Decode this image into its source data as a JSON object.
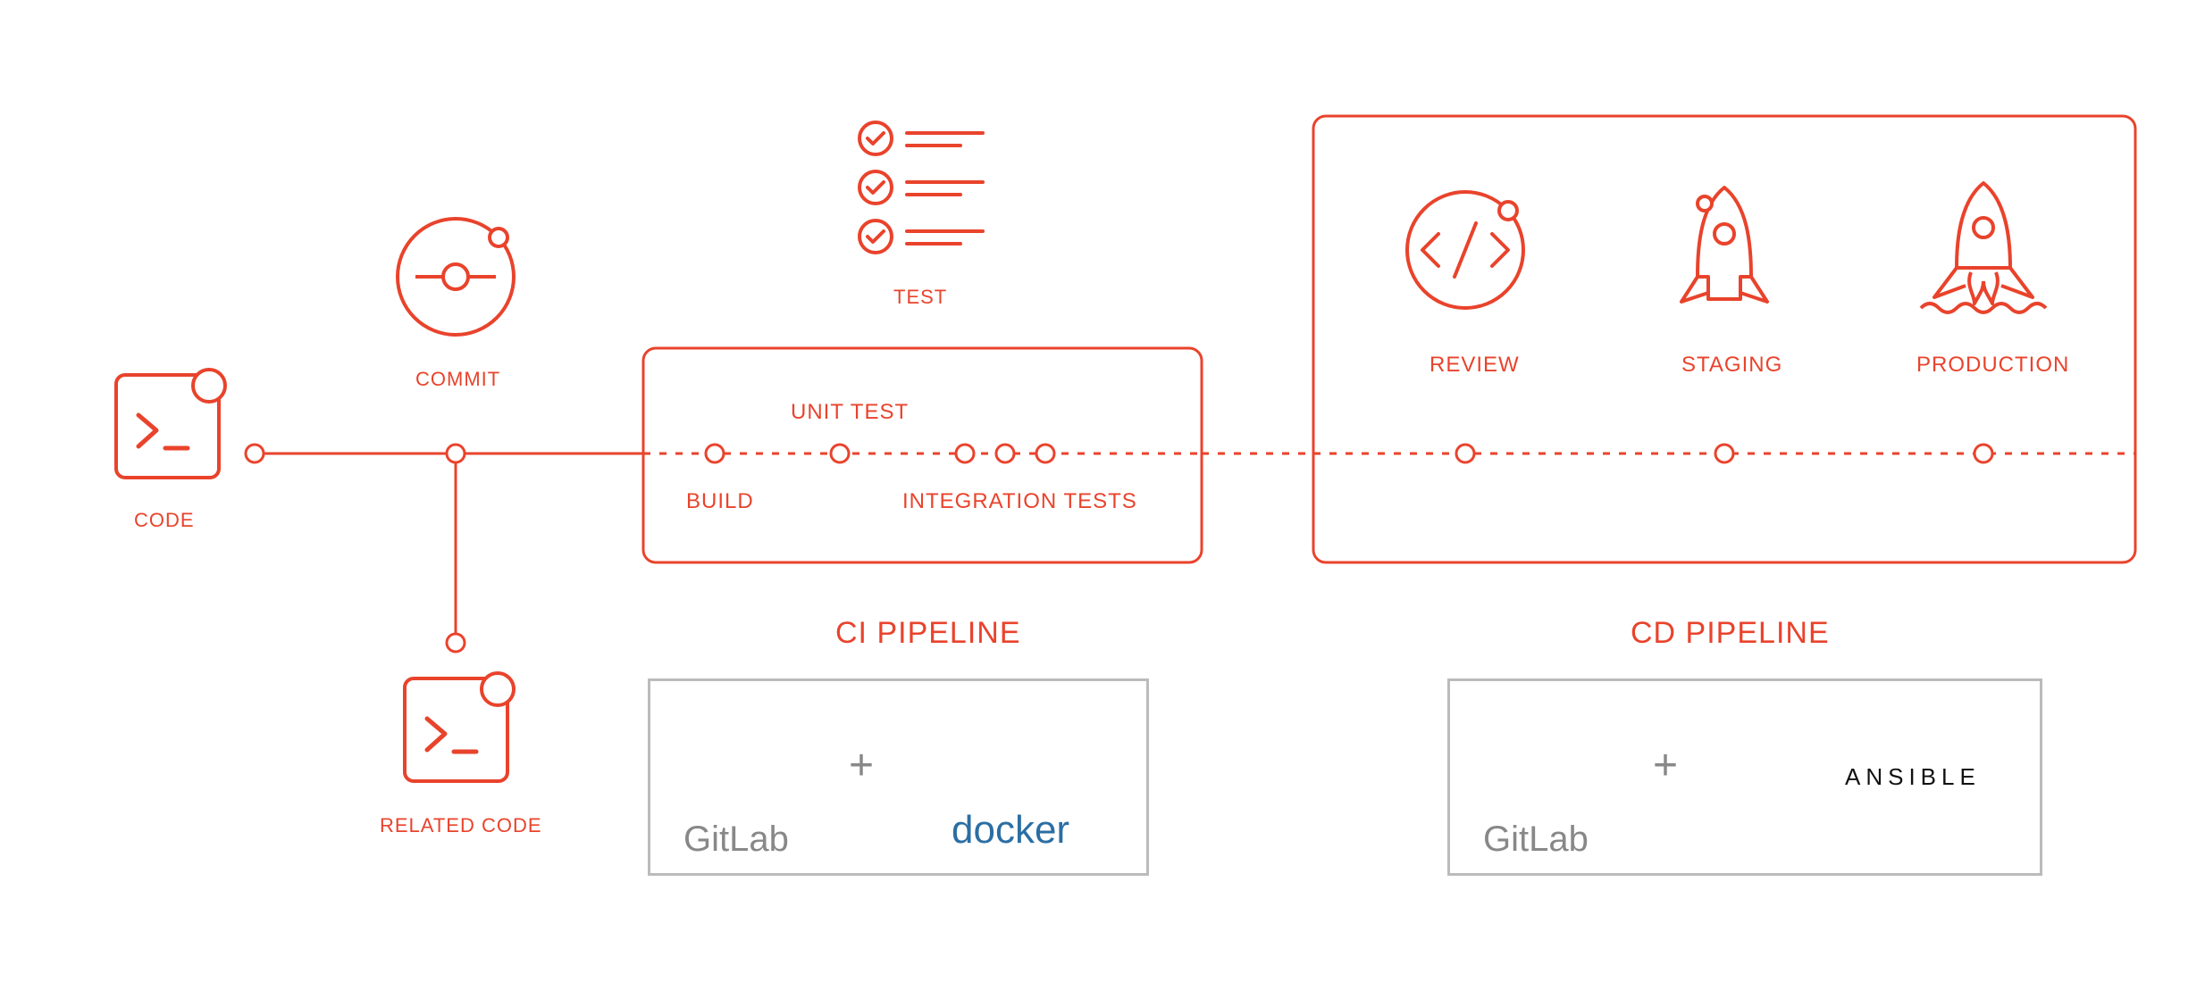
{
  "colors": {
    "accent": "#e9432c",
    "gray": "#888888",
    "docker_blue": "#2b6ea3",
    "gitlab_orange": "#fc6d26",
    "gitlab_red": "#e24329",
    "gitlab_amber": "#fca326"
  },
  "nodes": {
    "code": "CODE",
    "commit": "COMMIT",
    "related_code": "RELATED CODE",
    "test": "TEST"
  },
  "ci_pipeline": {
    "title": "CI PIPELINE",
    "build": "BUILD",
    "unit_test": "UNIT TEST",
    "integration_tests": "INTEGRATION TESTS"
  },
  "cd_pipeline": {
    "title": "CD PIPELINE",
    "review": "REVIEW",
    "staging": "STAGING",
    "production": "PRODUCTION"
  },
  "tools": {
    "gitlab": "GitLab",
    "docker": "docker",
    "ansible": "ANSIBLE",
    "plus": "+"
  }
}
